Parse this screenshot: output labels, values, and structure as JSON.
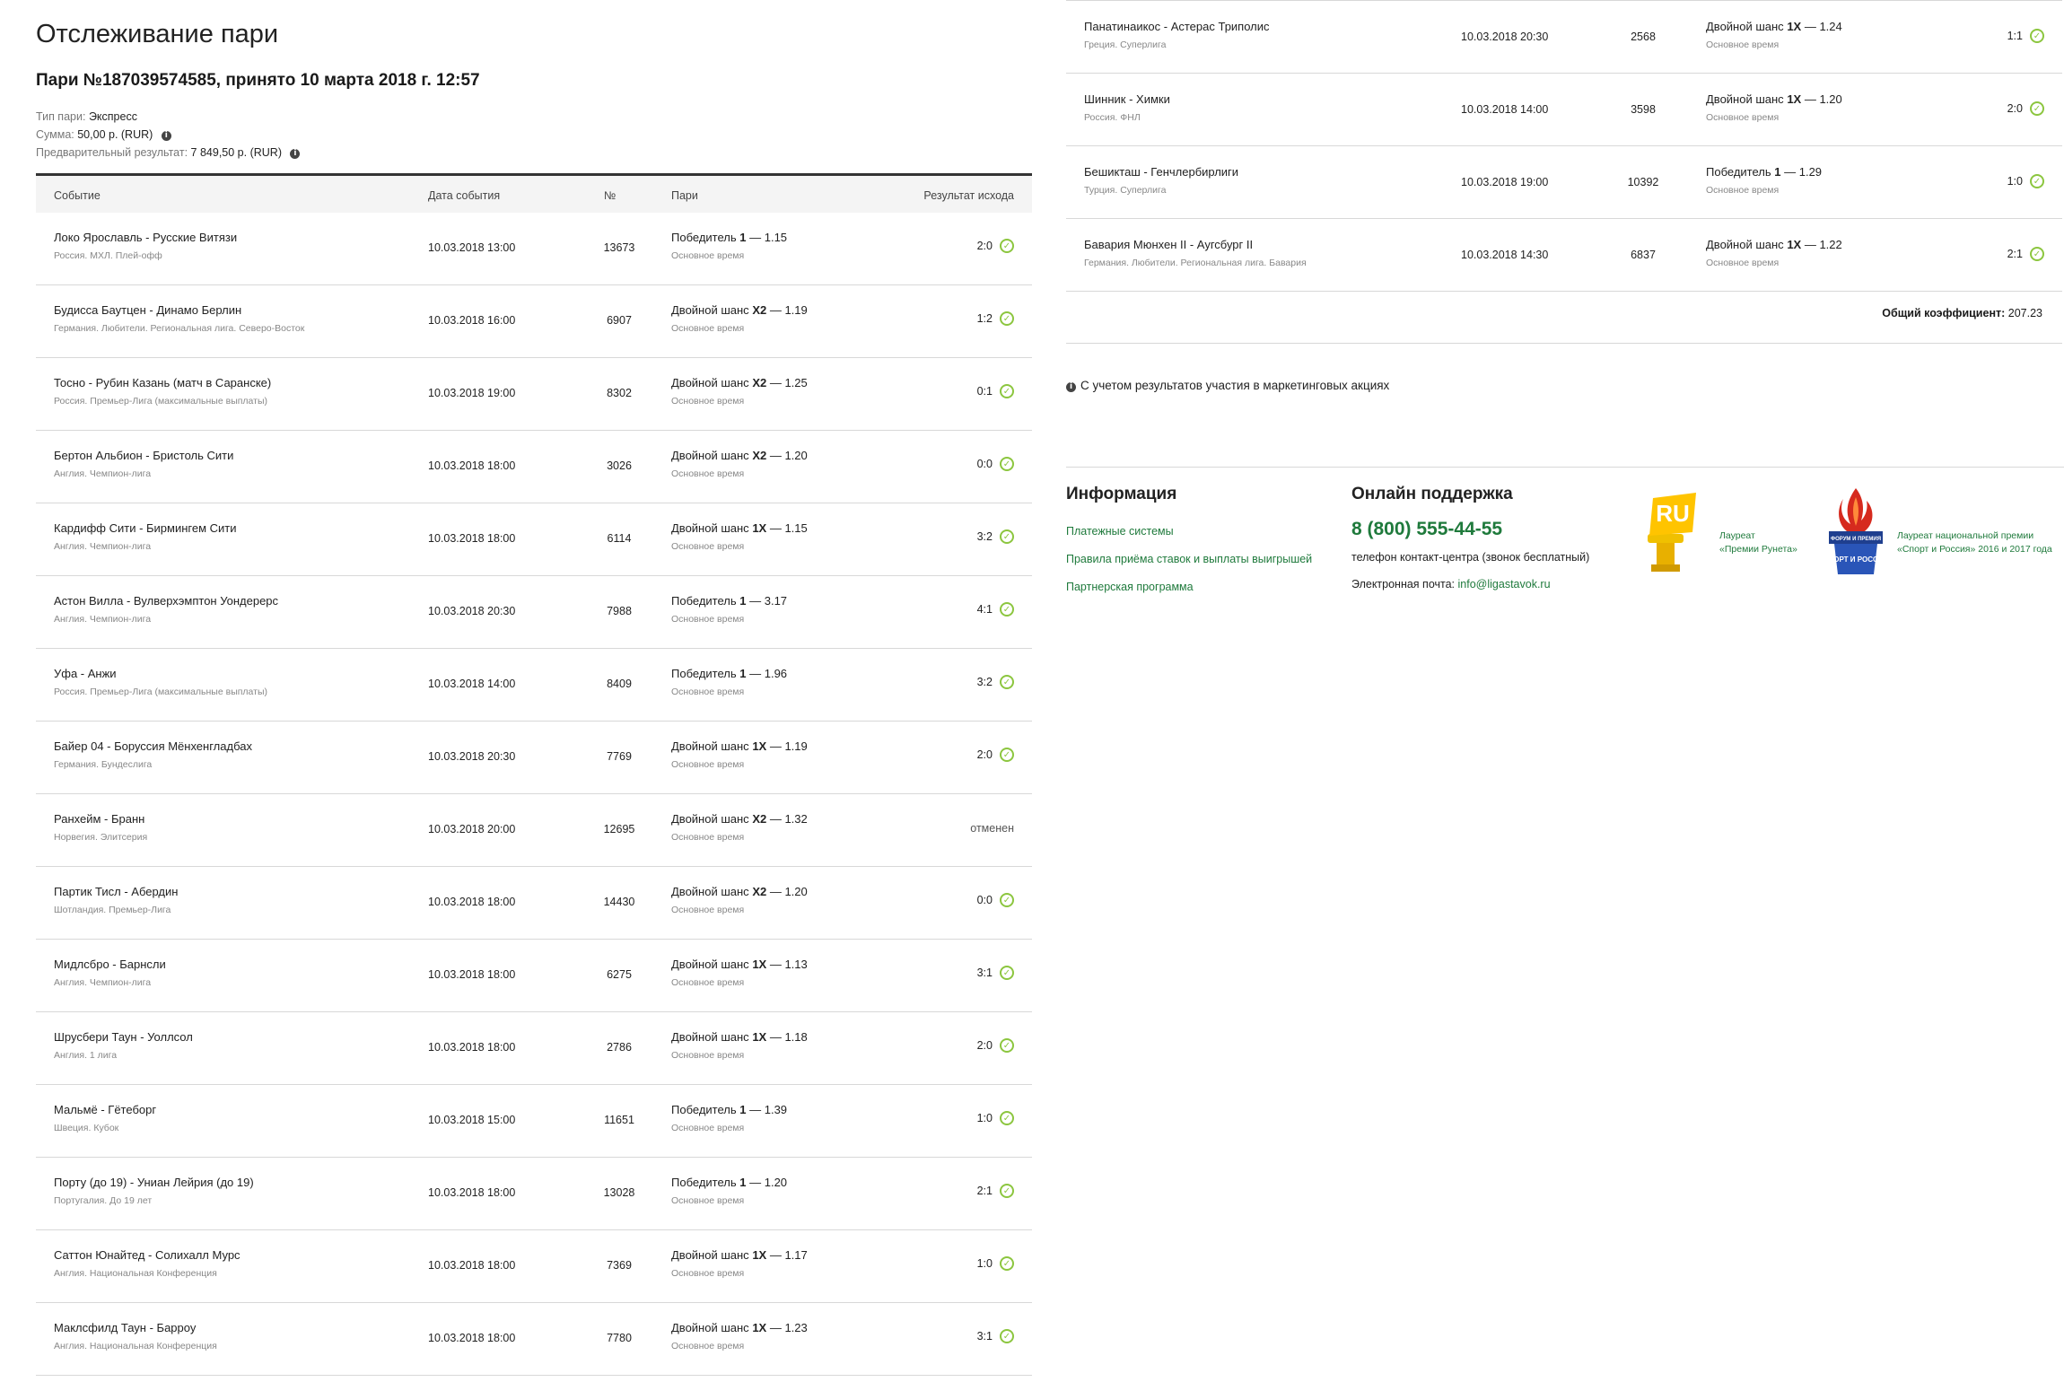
{
  "page_title": "Отслеживание пари",
  "bet_title": "Пари №187039574585, принято 10 марта 2018 г. 12:57",
  "meta": {
    "type_label": "Тип пари:",
    "type_value": "Экспресс",
    "sum_label": "Сумма:",
    "sum_value": "50,00 р. (RUR)",
    "prelim_label": "Предварительный результат:",
    "prelim_value": "7 849,50 р. (RUR)",
    "info_glyph": "i"
  },
  "columns": {
    "event": "Событие",
    "date": "Дата события",
    "num": "№",
    "bet": "Пари",
    "result": "Результат исхода"
  },
  "bet_time_label": "Основное время",
  "rows": [
    {
      "event": "Локо Ярославль - Русские Витязи",
      "league": "Россия. МХЛ. Плей-офф",
      "date": "10.03.2018 13:00",
      "num": "13673",
      "bet_type": "Победитель",
      "pick": "1",
      "odds": "— 1.15",
      "result": "2:0",
      "status": "won"
    },
    {
      "event": "Будисса Баутцен - Динамо Берлин",
      "league": "Германия. Любители. Региональная лига. Северо-Восток",
      "date": "10.03.2018 16:00",
      "num": "6907",
      "bet_type": "Двойной шанс",
      "pick": "X2",
      "odds": "— 1.19",
      "result": "1:2",
      "status": "won"
    },
    {
      "event": "Тосно - Рубин Казань (матч в Саранске)",
      "league": "Россия. Премьер-Лига (максимальные выплаты)",
      "date": "10.03.2018 19:00",
      "num": "8302",
      "bet_type": "Двойной шанс",
      "pick": "X2",
      "odds": "— 1.25",
      "result": "0:1",
      "status": "won"
    },
    {
      "event": "Бертон Альбион - Бристоль Сити",
      "league": "Англия. Чемпион-лига",
      "date": "10.03.2018 18:00",
      "num": "3026",
      "bet_type": "Двойной шанс",
      "pick": "X2",
      "odds": "— 1.20",
      "result": "0:0",
      "status": "won"
    },
    {
      "event": "Кардифф Сити - Бирмингем Сити",
      "league": "Англия. Чемпион-лига",
      "date": "10.03.2018 18:00",
      "num": "6114",
      "bet_type": "Двойной шанс",
      "pick": "1X",
      "odds": "— 1.15",
      "result": "3:2",
      "status": "won"
    },
    {
      "event": "Астон Вилла - Вулверхэмптон Уондерерс",
      "league": "Англия. Чемпион-лига",
      "date": "10.03.2018 20:30",
      "num": "7988",
      "bet_type": "Победитель",
      "pick": "1",
      "odds": "— 3.17",
      "result": "4:1",
      "status": "won"
    },
    {
      "event": "Уфа - Анжи",
      "league": "Россия. Премьер-Лига (максимальные выплаты)",
      "date": "10.03.2018 14:00",
      "num": "8409",
      "bet_type": "Победитель",
      "pick": "1",
      "odds": "— 1.96",
      "result": "3:2",
      "status": "won"
    },
    {
      "event": "Байер 04 - Боруссия Мёнхенгладбах",
      "league": "Германия. Бундеслига",
      "date": "10.03.2018 20:30",
      "num": "7769",
      "bet_type": "Двойной шанс",
      "pick": "1X",
      "odds": "— 1.19",
      "result": "2:0",
      "status": "won"
    },
    {
      "event": "Ранхейм - Бранн",
      "league": "Норвегия. Элитсерия",
      "date": "10.03.2018 20:00",
      "num": "12695",
      "bet_type": "Двойной шанс",
      "pick": "X2",
      "odds": "— 1.32",
      "result": "отменен",
      "status": "cancelled"
    },
    {
      "event": "Партик Тисл - Абердин",
      "league": "Шотландия. Премьер-Лига",
      "date": "10.03.2018 18:00",
      "num": "14430",
      "bet_type": "Двойной шанс",
      "pick": "X2",
      "odds": "— 1.20",
      "result": "0:0",
      "status": "won"
    },
    {
      "event": "Мидлсбро - Барнсли",
      "league": "Англия. Чемпион-лига",
      "date": "10.03.2018 18:00",
      "num": "6275",
      "bet_type": "Двойной шанс",
      "pick": "1X",
      "odds": "— 1.13",
      "result": "3:1",
      "status": "won"
    },
    {
      "event": "Шрусбери Таун - Уоллсол",
      "league": "Англия. 1 лига",
      "date": "10.03.2018 18:00",
      "num": "2786",
      "bet_type": "Двойной шанс",
      "pick": "1X",
      "odds": "— 1.18",
      "result": "2:0",
      "status": "won"
    },
    {
      "event": "Мальмё - Гётеборг",
      "league": "Швеция. Кубок",
      "date": "10.03.2018 15:00",
      "num": "11651",
      "bet_type": "Победитель",
      "pick": "1",
      "odds": "— 1.39",
      "result": "1:0",
      "status": "won"
    },
    {
      "event": "Порту (до 19) - Униан Лейрия (до 19)",
      "league": "Португалия. До 19 лет",
      "date": "10.03.2018 18:00",
      "num": "13028",
      "bet_type": "Победитель",
      "pick": "1",
      "odds": "— 1.20",
      "result": "2:1",
      "status": "won"
    },
    {
      "event": "Саттон Юнайтед - Солихалл Мурс",
      "league": "Англия. Национальная Конференция",
      "date": "10.03.2018 18:00",
      "num": "7369",
      "bet_type": "Двойной шанс",
      "pick": "1X",
      "odds": "— 1.17",
      "result": "1:0",
      "status": "won"
    },
    {
      "event": "Маклсфилд Таун - Барроу",
      "league": "Англия. Национальная Конференция",
      "date": "10.03.2018 18:00",
      "num": "7780",
      "bet_type": "Двойной шанс",
      "pick": "1X",
      "odds": "— 1.23",
      "result": "3:1",
      "status": "won"
    }
  ],
  "right_rows": [
    {
      "event": "Панатинаикос - Астерас Триполис",
      "league": "Греция. Суперлига",
      "date": "10.03.2018 20:30",
      "num": "2568",
      "bet_type": "Двойной шанс",
      "pick": "1X",
      "odds": "— 1.24",
      "result": "1:1",
      "status": "won"
    },
    {
      "event": "Шинник - Химки",
      "league": "Россия. ФНЛ",
      "date": "10.03.2018 14:00",
      "num": "3598",
      "bet_type": "Двойной шанс",
      "pick": "1X",
      "odds": "— 1.20",
      "result": "2:0",
      "status": "won"
    },
    {
      "event": "Бешикташ - Генчлербирлиги",
      "league": "Турция. Суперлига",
      "date": "10.03.2018 19:00",
      "num": "10392",
      "bet_type": "Победитель",
      "pick": "1",
      "odds": "— 1.29",
      "result": "1:0",
      "status": "won"
    },
    {
      "event": "Бавария Мюнхен II - Аугсбург II",
      "league": "Германия. Любители. Региональная лига. Бавария",
      "date": "10.03.2018 14:30",
      "num": "6837",
      "bet_type": "Двойной шанс",
      "pick": "1X",
      "odds": "— 1.22",
      "result": "2:1",
      "status": "won"
    }
  ],
  "total": {
    "label": "Общий коэффициент:",
    "value": "207.23"
  },
  "note": "С учетом результатов участия в маркетинговых акциях",
  "footer": {
    "info_title": "Информация",
    "links": [
      "Платежные системы",
      "Правила приёма ставок и выплаты выигрышей",
      "Партнерская программа"
    ],
    "support_title": "Онлайн поддержка",
    "phone": "8 (800) 555-44-55",
    "phone_note": "телефон контакт-центра (звонок бесплатный)",
    "email_label": "Электронная почта:",
    "email": "info@ligastavok.ru",
    "award1_line1": "Лауреат",
    "award1_line2": "«Премии Рунета»",
    "award1_logo": "RU",
    "award2_line1": "Лауреат национальной премии",
    "award2_line2": "«Спорт и Россия» 2016 и 2017 года",
    "award2_logo_top": "ФОРУМ И ПРЕМИЯ",
    "award2_logo_main": "СПОРТ И РОССИЯ"
  },
  "colors": {
    "accent": "#1f7a3c",
    "check": "#8cc63f",
    "header_border": "#333333"
  }
}
